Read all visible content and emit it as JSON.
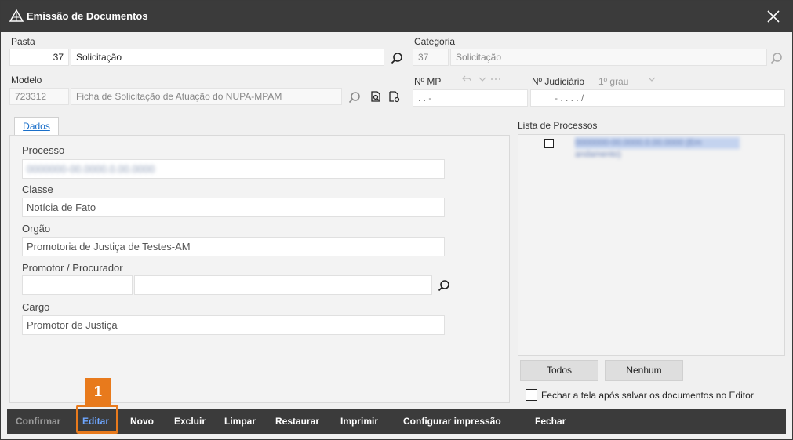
{
  "window": {
    "title": "Emissão de Documentos"
  },
  "pasta": {
    "label": "Pasta",
    "code": "37",
    "value": "Solicitação"
  },
  "categoria": {
    "label": "Categoria",
    "code": "37",
    "value": "Solicitação"
  },
  "modelo": {
    "label": "Modelo",
    "code": "723312",
    "value": "Ficha de Solicitação de Atuação do NUPA-MPAM"
  },
  "nmp": {
    "label": "Nº MP",
    "value": ".     .         -"
  },
  "judiciario": {
    "label": "Nº Judiciário",
    "grau": "1º grau",
    "value": "-     .     .     .     .     /"
  },
  "tabs": {
    "dados": "Dados"
  },
  "form": {
    "processo_label": "Processo",
    "processo_value": "0000000-00.0000.0.00.0000",
    "classe_label": "Classe",
    "classe_value": "Notícia de Fato",
    "orgao_label": "Orgão",
    "orgao_value": "Promotoria de Justiça de Testes-AM",
    "promotor_label": "Promotor / Procurador",
    "promotor_code": "",
    "promotor_name": "",
    "cargo_label": "Cargo",
    "cargo_value": "Promotor de Justiça"
  },
  "lista": {
    "label": "Lista de Processos",
    "items": [
      {
        "text": "0000000-00.0000.0.00.0000 (Em andamento)"
      }
    ],
    "todos": "Todos",
    "nenhum": "Nenhum",
    "fechar_checkbox": "Fechar a tela após salvar os documentos no Editor"
  },
  "toolbar": {
    "confirmar": "Confirmar",
    "editar": "Editar",
    "novo": "Novo",
    "excluir": "Excluir",
    "limpar": "Limpar",
    "restaurar": "Restaurar",
    "imprimir": "Imprimir",
    "configurar": "Configurar impressão",
    "fechar": "Fechar"
  },
  "highlight": {
    "badge": "1"
  },
  "colors": {
    "accent": "#e87a1c",
    "titlebar": "#3b3b3b",
    "active": "#6ea6ff"
  }
}
